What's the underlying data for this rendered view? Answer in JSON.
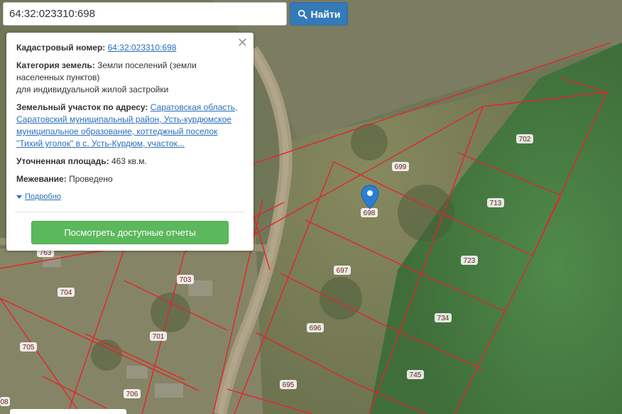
{
  "search": {
    "value": "64:32:023310:698",
    "button_label": "Найти"
  },
  "panel": {
    "cadastral_label": "Кадастровый номер:",
    "cadastral_value": "64:32:023310:698",
    "category_label": "Категория земель:",
    "category_value_1": "Земли поселений (земли",
    "category_value_2": "населенных пунктов)",
    "category_value_3": "для индивидуальной жилой застройки",
    "address_label": "Земельный участок по адресу:",
    "address_line_1": "Саратовская область,",
    "address_line_2": "Саратовский муниципальный район, Усть-курдюмское",
    "address_line_3": "муниципальное образование, коттеджный поселок",
    "address_line_4": "\"Тихий уголок\" в с. Усть-Курдюм, участок...",
    "area_label": "Уточненная площадь:",
    "area_value": "463 кв.м.",
    "survey_label": "Межевание:",
    "survey_value": "Проведено",
    "details_link": "Подробно",
    "reports_button": "Посмотреть доступные отчеты"
  },
  "parcel_labels": [
    "699",
    "698",
    "702",
    "713",
    "723",
    "697",
    "734",
    "696",
    "745",
    "695",
    "703",
    "704",
    "701",
    "705",
    "706",
    "763",
    "08"
  ],
  "colors": {
    "parcel_line": "#e0262b",
    "marker": "#2a7fd4",
    "primary": "#337ab7",
    "success": "#5cb85c"
  }
}
